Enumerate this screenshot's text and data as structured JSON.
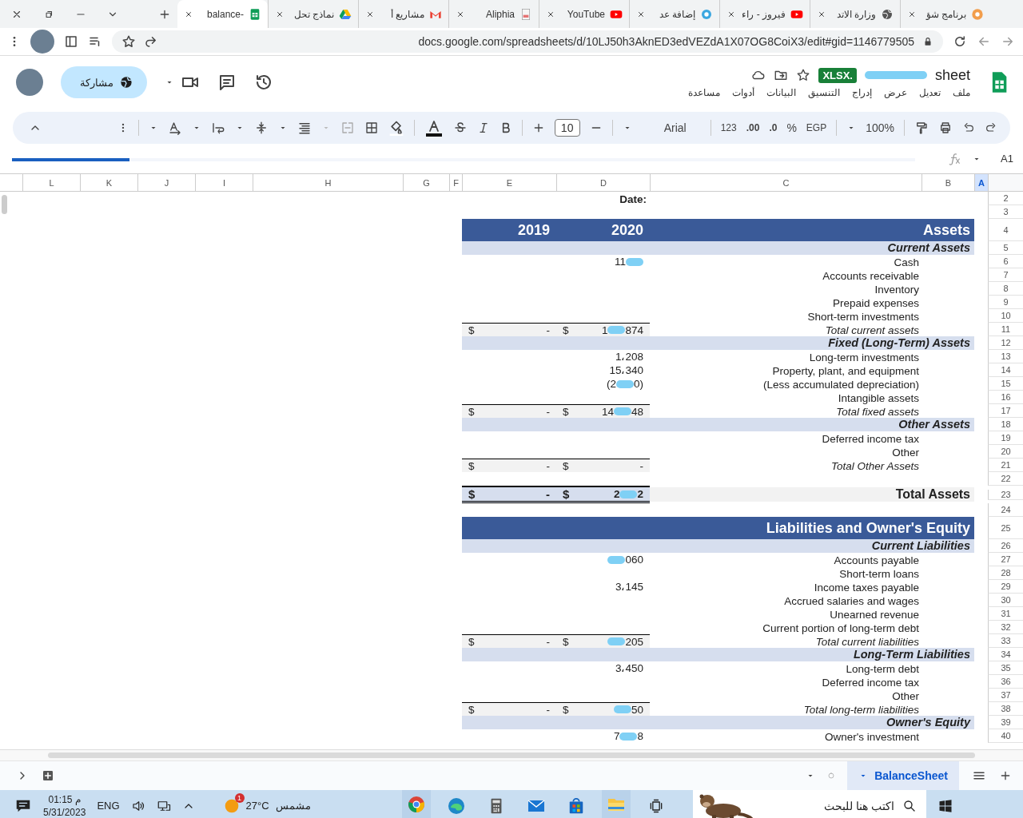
{
  "browser": {
    "tabs": [
      {
        "title": "برنامج شؤ",
        "kind": "orange",
        "selected": false
      },
      {
        "title": "وزارة الاتد",
        "kind": "globe",
        "selected": false
      },
      {
        "title": "فيروز - راء",
        "kind": "youtube",
        "selected": false
      },
      {
        "title": "إضافة عد",
        "kind": "dot",
        "selected": false
      },
      {
        "title": "YouTube",
        "kind": "youtube",
        "selected": false
      },
      {
        "title": "Aliphia",
        "kind": "doc",
        "selected": false
      },
      {
        "title": "مشاريع أ",
        "kind": "gmail",
        "selected": false
      },
      {
        "title": "نماذج تحل",
        "kind": "drive",
        "selected": false
      },
      {
        "title": "balance-",
        "kind": "sheets",
        "selected": true
      }
    ],
    "url": "docs.google.com/spreadsheets/d/10LJ50h3AknED3edVEZdA1X07OG8CoiX3/edit#gid=1146779505"
  },
  "doc": {
    "badge": "XLSX.",
    "title": "sheet",
    "share": "مشاركة",
    "menu": [
      "ملف",
      "تعديل",
      "عرض",
      "إدراج",
      "التنسيق",
      "البيانات",
      "أدوات",
      "مساعدة"
    ]
  },
  "loading": {
    "level": 0.13
  },
  "toolbar": {
    "zoom": "100%",
    "currency": "EGP",
    "percent": "%",
    "decimals_less": ".0",
    "decimals_more": ".00",
    "number_format": "123",
    "font": "Arial",
    "font_size": "10"
  },
  "name_box": "A1",
  "columns": [
    {
      "label": "L",
      "selected": false
    },
    {
      "label": "K",
      "selected": false
    },
    {
      "label": "J",
      "selected": false
    },
    {
      "label": "I",
      "selected": false
    },
    {
      "label": "H",
      "selected": false
    },
    {
      "label": "G",
      "selected": false
    },
    {
      "label": "F",
      "selected": false
    },
    {
      "label": "E",
      "selected": false
    },
    {
      "label": "D",
      "selected": false
    },
    {
      "label": "C",
      "selected": false
    },
    {
      "label": "B",
      "selected": false
    },
    {
      "label": "A",
      "selected": true
    }
  ],
  "rows": [
    {
      "number": "2",
      "kind": "date",
      "heading": "Date:"
    },
    {
      "number": "3",
      "kind": "blank"
    },
    {
      "number": "4",
      "kind": "title",
      "label": "Assets",
      "year_e": "2019",
      "year_d": "2020"
    },
    {
      "number": "5",
      "kind": "section",
      "label": "Current Assets"
    },
    {
      "number": "6",
      "kind": "item",
      "label": "Cash",
      "value_start": "11",
      "redacted": true
    },
    {
      "number": "7",
      "kind": "item",
      "label": "Accounts receivable"
    },
    {
      "number": "8",
      "kind": "item",
      "label": "Inventory"
    },
    {
      "number": "9",
      "kind": "item",
      "label": "Prepaid expenses"
    },
    {
      "number": "10",
      "kind": "item",
      "label": "Short-term investments"
    },
    {
      "number": "11",
      "kind": "total",
      "label": "Total current assets",
      "e_currency": "$",
      "e_amount": "-",
      "d_currency": "$",
      "value_start": "1",
      "value_end": "874",
      "redacted": true
    },
    {
      "number": "12",
      "kind": "section",
      "label": "Fixed (Long-Term) Assets"
    },
    {
      "number": "13",
      "kind": "item",
      "label": "Long-term investments",
      "value_start": "1،208",
      "redacted": false
    },
    {
      "number": "14",
      "kind": "item",
      "label": "Property, plant, and equipment",
      "value_start": "15،340",
      "redacted": false
    },
    {
      "number": "15",
      "kind": "item",
      "label": "(Less accumulated depreciation)",
      "value_start": "(2",
      "value_end": "0)",
      "redacted": true
    },
    {
      "number": "16",
      "kind": "item",
      "label": "Intangible assets"
    },
    {
      "number": "17",
      "kind": "total",
      "label": "Total fixed assets",
      "e_currency": "$",
      "e_amount": "-",
      "d_currency": "$",
      "value_start": "14",
      "value_end": "48",
      "redacted": true
    },
    {
      "number": "18",
      "kind": "section",
      "label": "Other Assets"
    },
    {
      "number": "19",
      "kind": "item",
      "label": "Deferred income tax"
    },
    {
      "number": "20",
      "kind": "item",
      "label": "Other"
    },
    {
      "number": "21",
      "kind": "total",
      "label": "Total Other Assets",
      "e_currency": "$",
      "e_amount": "-",
      "d_currency": "$",
      "value_start": "-",
      "redacted": false
    },
    {
      "number": "22",
      "kind": "blank"
    },
    {
      "number": "23",
      "kind": "grand",
      "label": "Total Assets",
      "e_currency": "$",
      "e_amount": "-",
      "d_currency": "$",
      "value_start": "2",
      "value_end": "2",
      "redacted": true
    },
    {
      "number": "24",
      "kind": "blank"
    },
    {
      "number": "25",
      "kind": "title",
      "label": "Liabilities and Owner's Equity"
    },
    {
      "number": "26",
      "kind": "section",
      "label": "Current Liabilities"
    },
    {
      "number": "27",
      "kind": "item",
      "label": "Accounts payable",
      "value_end": "060",
      "redacted": true
    },
    {
      "number": "28",
      "kind": "item",
      "label": "Short-term loans"
    },
    {
      "number": "29",
      "kind": "item",
      "label": "Income taxes payable",
      "value_start": "3،145",
      "redacted": false
    },
    {
      "number": "30",
      "kind": "item",
      "label": "Accrued salaries and wages"
    },
    {
      "number": "31",
      "kind": "item",
      "label": "Unearned revenue"
    },
    {
      "number": "32",
      "kind": "item",
      "label": "Current portion of long-term debt"
    },
    {
      "number": "33",
      "kind": "total",
      "label": "Total current liabilities",
      "e_currency": "$",
      "e_amount": "-",
      "d_currency": "$",
      "value_end": "205",
      "redacted": true
    },
    {
      "number": "34",
      "kind": "section",
      "label": "Long-Term Liabilities"
    },
    {
      "number": "35",
      "kind": "item",
      "label": "Long-term debt",
      "value_start": "3،450",
      "redacted": false
    },
    {
      "number": "36",
      "kind": "item",
      "label": "Deferred income tax"
    },
    {
      "number": "37",
      "kind": "item",
      "label": "Other"
    },
    {
      "number": "38",
      "kind": "total",
      "label": "Total long-term liabilities",
      "e_currency": "$",
      "e_amount": "-",
      "d_currency": "$",
      "value_end": "50",
      "redacted": true
    },
    {
      "number": "39",
      "kind": "section",
      "label": "Owner's Equity"
    },
    {
      "number": "40",
      "kind": "item",
      "label": "Owner's investment",
      "value_start": "7",
      "value_end": "8",
      "redacted": true
    }
  ],
  "sheet_tabs": [
    {
      "name": "BalanceSheet",
      "selected": true
    }
  ],
  "taskbar": {
    "time": "01:15 م",
    "date": "5/31/2023",
    "language": "ENG",
    "weather_badge": "1",
    "temperature": "27°C",
    "weather": "مشمس",
    "search_placeholder": "اكتب هنا للبحث"
  }
}
